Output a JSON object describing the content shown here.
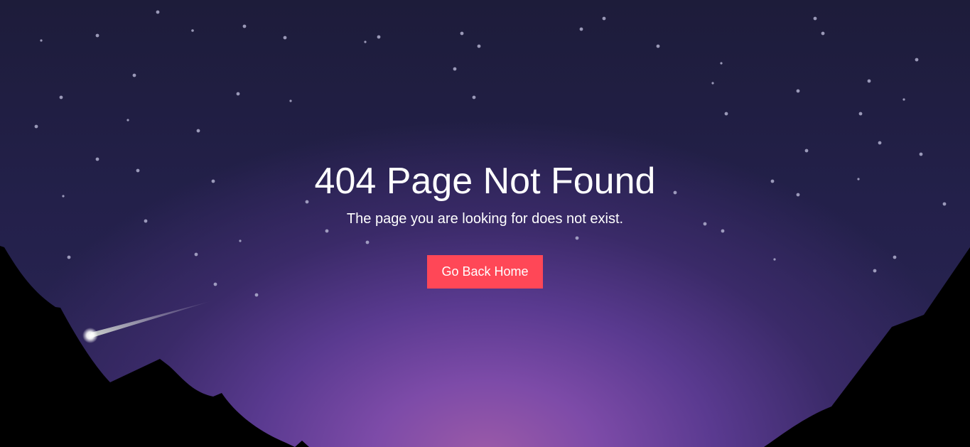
{
  "page": {
    "title": "404 Page Not Found",
    "message": "The page you are looking for does not exist.",
    "home_button_label": "Go Back Home"
  },
  "colors": {
    "sky_top": "#1e1d3a",
    "horizon_glow": "#9b5aa8",
    "button": "#ff4757",
    "mountains": "#000000",
    "text": "#ffffff"
  }
}
